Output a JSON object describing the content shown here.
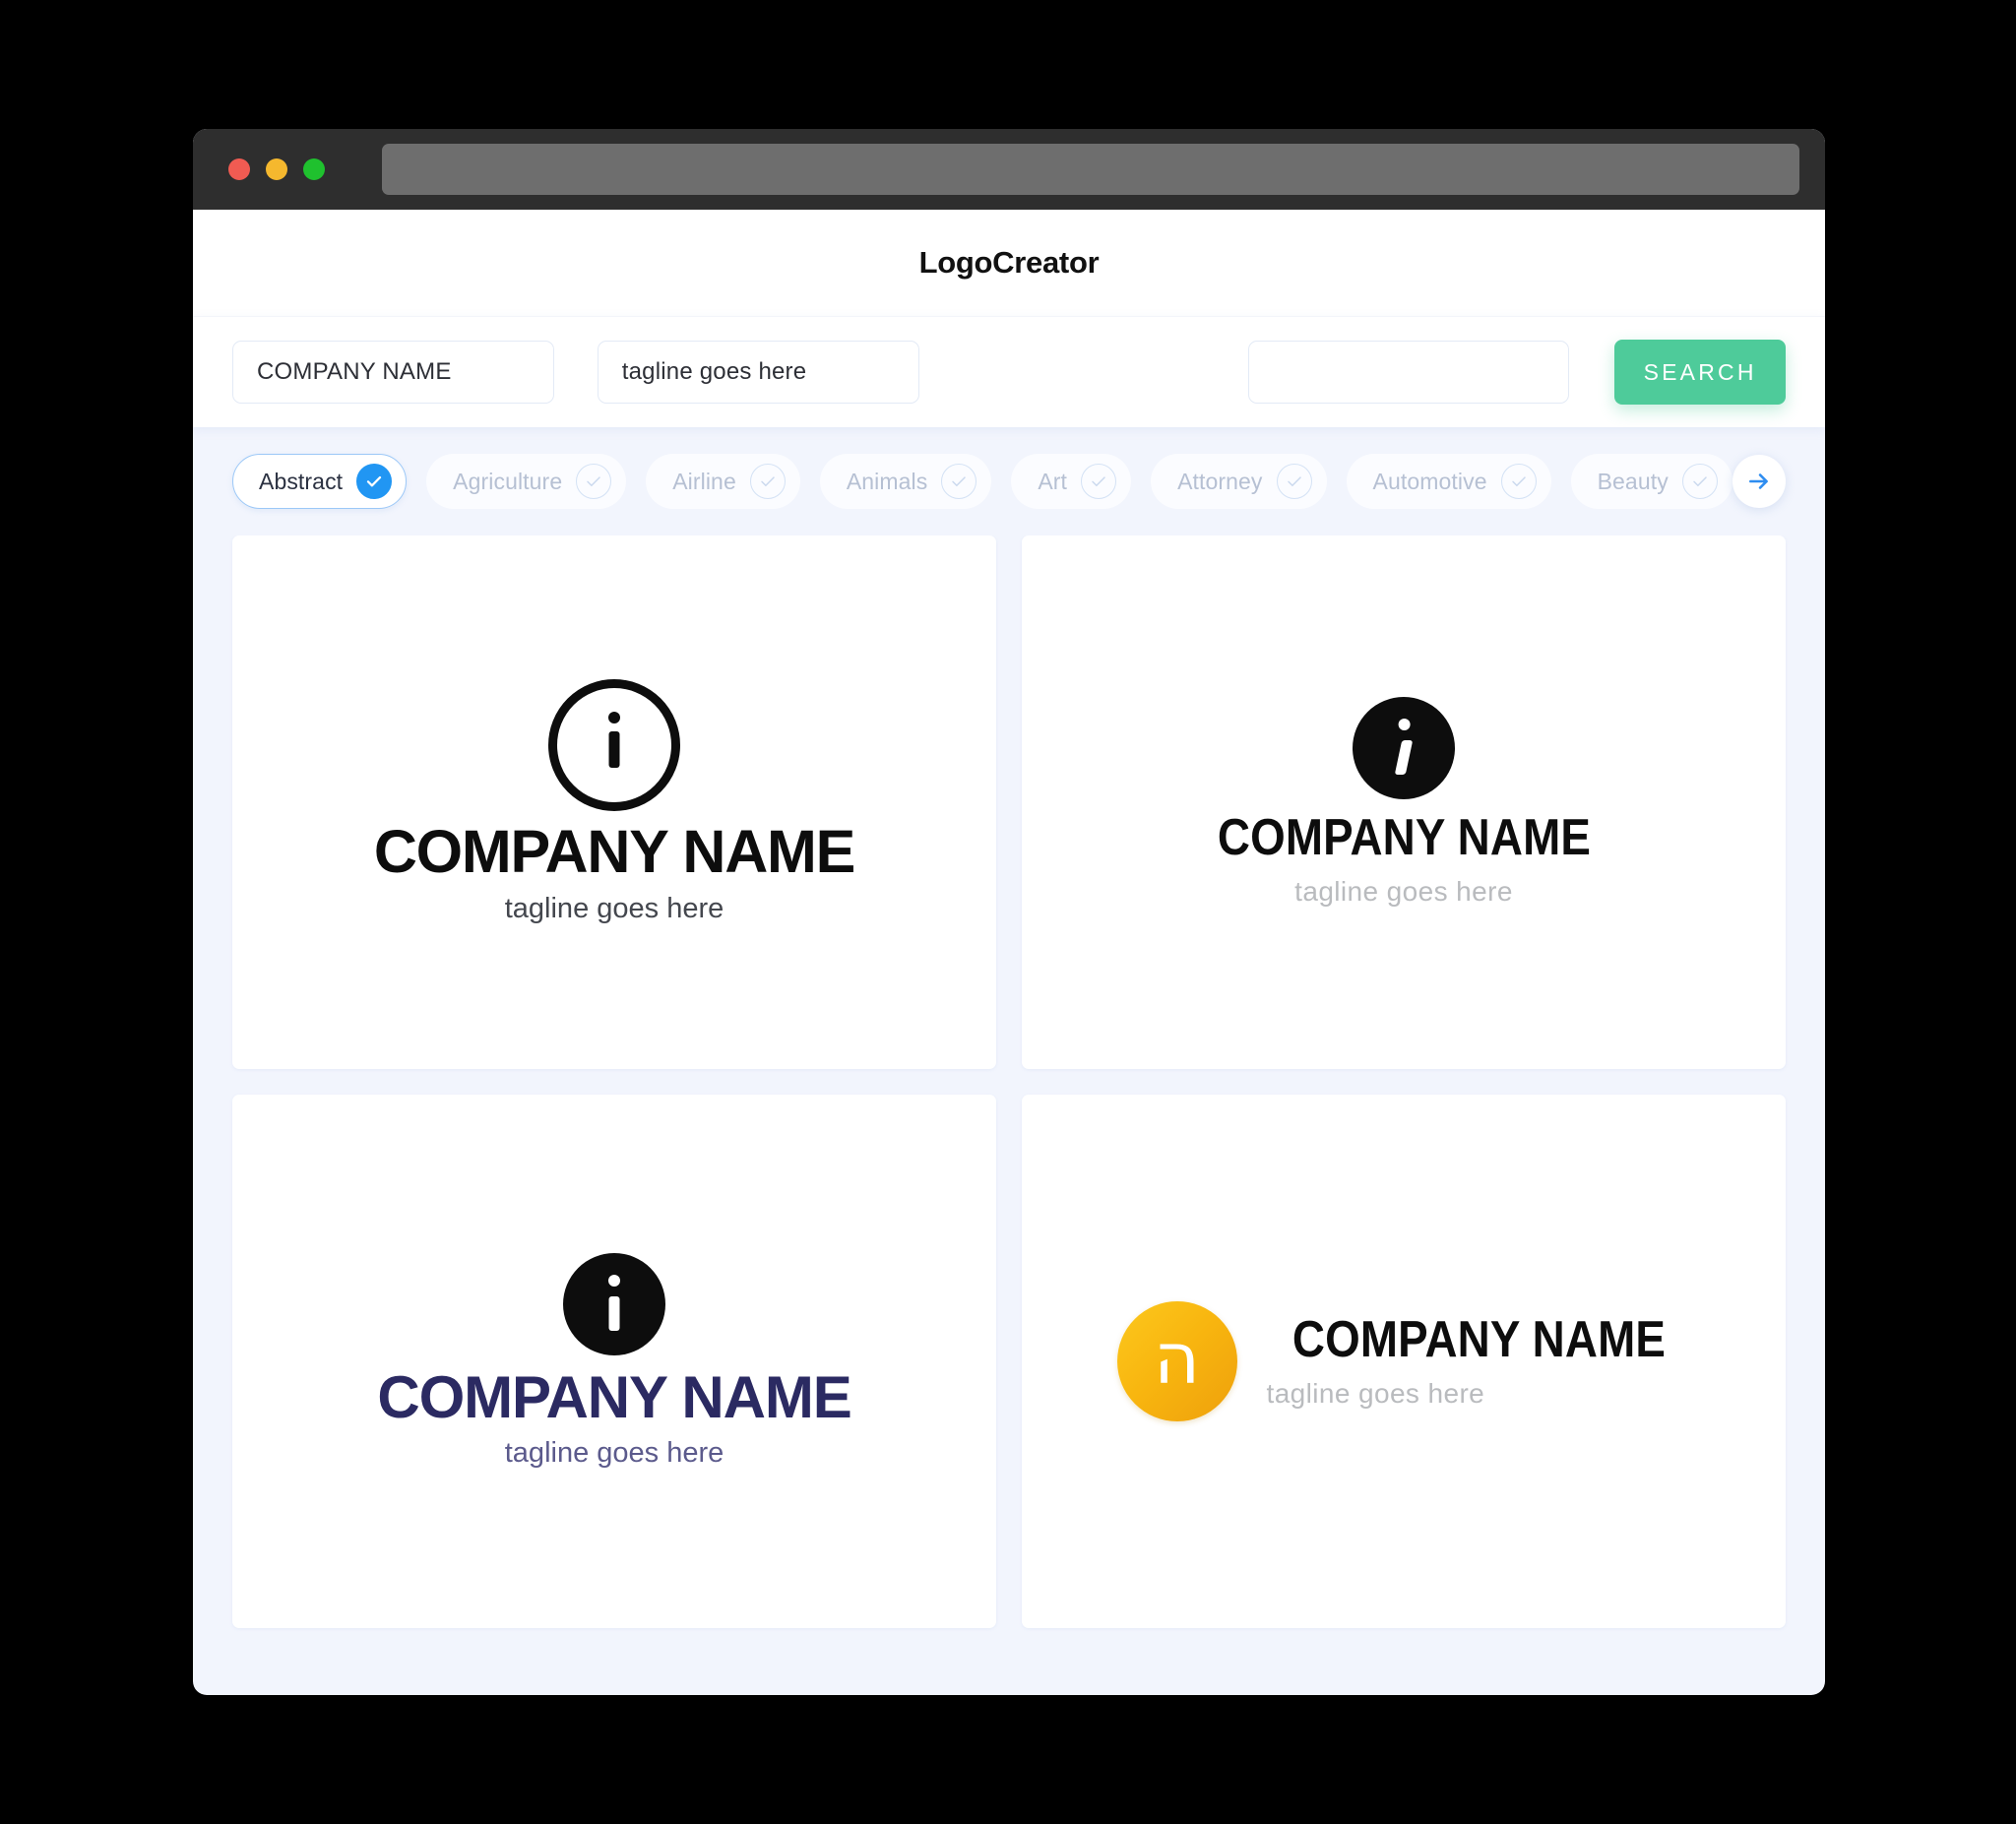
{
  "window": {
    "traffic_lights": [
      "close",
      "minimize",
      "maximize"
    ],
    "url_value": ""
  },
  "header": {
    "app_title": "LogoCreator"
  },
  "search": {
    "company_value": "COMPANY NAME",
    "company_placeholder": "COMPANY NAME",
    "tagline_value": "tagline goes here",
    "tagline_placeholder": "tagline goes here",
    "extra_value": "",
    "extra_placeholder": "",
    "button_label": "SEARCH",
    "button_color": "#4ecb9a"
  },
  "categories": {
    "selected": "Abstract",
    "accent_color": "#2196f3",
    "next_icon": "arrow-right-icon",
    "items": [
      {
        "label": "Abstract",
        "selected": true
      },
      {
        "label": "Agriculture",
        "selected": false
      },
      {
        "label": "Airline",
        "selected": false
      },
      {
        "label": "Animals",
        "selected": false
      },
      {
        "label": "Art",
        "selected": false
      },
      {
        "label": "Attorney",
        "selected": false
      },
      {
        "label": "Automotive",
        "selected": false
      },
      {
        "label": "Beauty",
        "selected": false
      }
    ]
  },
  "results": [
    {
      "id": "logo-1",
      "icon": "info-circle-outline-icon",
      "company_name": "COMPANY NAME",
      "tagline": "tagline goes here",
      "name_color": "#0d0d0d",
      "tagline_color": "#44474e",
      "mark_color": "#0d0d0d",
      "layout": "stacked"
    },
    {
      "id": "logo-2",
      "icon": "info-circle-solid-italic-icon",
      "company_name": "COMPANY NAME",
      "tagline": "tagline goes here",
      "name_color": "#0d0d0d",
      "tagline_color": "#b9bbbe",
      "mark_color": "#0d0d0d",
      "layout": "stacked"
    },
    {
      "id": "logo-3",
      "icon": "info-circle-solid-icon",
      "company_name": "COMPANY NAME",
      "tagline": "tagline goes here",
      "name_color": "#2b2a62",
      "tagline_color": "#5b5a8c",
      "mark_color": "#0d0d0d",
      "layout": "stacked"
    },
    {
      "id": "logo-4",
      "icon": "hebrew-he-circle-icon",
      "glyph": "ה",
      "company_name": "COMPANY NAME",
      "tagline": "tagline goes here",
      "name_color": "#0d0d0d",
      "tagline_color": "#b9bbbe",
      "mark_color_from": "#fcc81d",
      "mark_color_to": "#eea00c",
      "layout": "horizontal"
    }
  ]
}
